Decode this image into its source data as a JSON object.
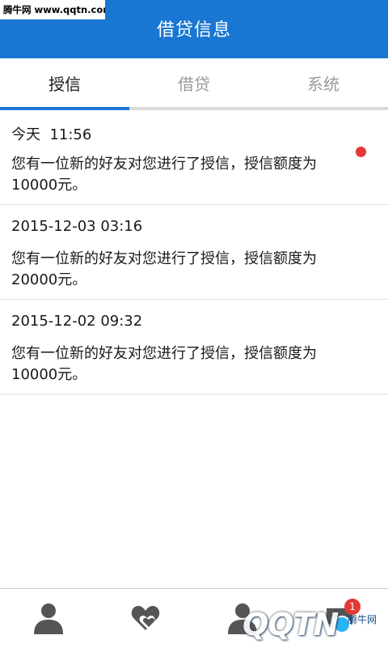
{
  "watermark": {
    "top_left": "腾牛网 www.qqtn.com",
    "bottom_logo": "QQTN",
    "bottom_sub": "腾牛网"
  },
  "header": {
    "title": "借贷信息"
  },
  "tabs": [
    {
      "label": "授信",
      "active": true
    },
    {
      "label": "借贷",
      "active": false
    },
    {
      "label": "系统",
      "active": false
    }
  ],
  "messages": [
    {
      "time": "今天  11:56",
      "body": "您有一位新的好友对您进行了授信，授信额度为10000元。",
      "unread": true
    },
    {
      "time": "2015-12-03 03:16",
      "body": "您有一位新的好友对您进行了授信，授信额度为20000元。",
      "unread": false
    },
    {
      "time": "2015-12-02 09:32",
      "body": "您有一位新的好友对您进行了授信，授信额度为10000元。",
      "unread": false
    }
  ],
  "bottom_nav": {
    "items": [
      {
        "icon": "person-icon"
      },
      {
        "icon": "hearts-icon"
      },
      {
        "icon": "person-icon"
      },
      {
        "icon": "message-icon",
        "badge": "1"
      }
    ]
  },
  "colors": {
    "primary": "#1976d2",
    "unread_dot": "#e53935",
    "tab_inactive_text": "#9a9a9a"
  }
}
